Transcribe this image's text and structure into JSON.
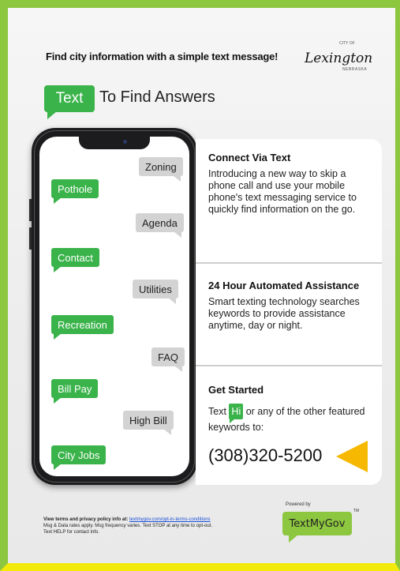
{
  "header": {
    "headline": "Find city information with a simple text message!",
    "logo_city_of": "CITY OF",
    "logo_name": "Lexington",
    "logo_state": "NEBRASKA"
  },
  "title": {
    "bubble": "Text",
    "rest": "To Find Answers"
  },
  "phone_bubbles": [
    {
      "label": "Zoning",
      "kind": "sent"
    },
    {
      "label": "Pothole",
      "kind": "received"
    },
    {
      "label": "Agenda",
      "kind": "sent"
    },
    {
      "label": "Contact",
      "kind": "received"
    },
    {
      "label": "Utilities",
      "kind": "sent"
    },
    {
      "label": "Recreation",
      "kind": "received"
    },
    {
      "label": "FAQ",
      "kind": "sent"
    },
    {
      "label": "Bill Pay",
      "kind": "received"
    },
    {
      "label": "High Bill",
      "kind": "sent"
    },
    {
      "label": "City Jobs",
      "kind": "received"
    }
  ],
  "sections": {
    "connect": {
      "heading": "Connect Via Text",
      "body": "Introducing a new way to skip a phone call and use your mobile phone's text messaging service to quickly find information on the go."
    },
    "assist": {
      "heading": "24 Hour Automated Assistance",
      "body": "Smart texting technology searches keywords to provide assistance anytime, day or night."
    },
    "start": {
      "heading": "Get Started",
      "prefix": "Text",
      "keyword": "Hi",
      "suffix": "or any of the other featured keywords to:",
      "number": "(308)320-5200"
    }
  },
  "footer": {
    "terms_prefix": "View terms and privacy policy info at:",
    "terms_link": "textmygov.com/opt-in-terms-conditions",
    "line2": "Msg & Data rates apply. Msg frequency varies. Text STOP at any time to opt-out.",
    "line3": "Text HELP for contact info.",
    "powered_by": "Powered by",
    "brand": "TextMyGov",
    "tm": "TM"
  },
  "colors": {
    "green": "#3ab34a",
    "lime_border": "#8dc63f",
    "yellow_border": "#f2ea0a",
    "arrow": "#f6b800"
  }
}
